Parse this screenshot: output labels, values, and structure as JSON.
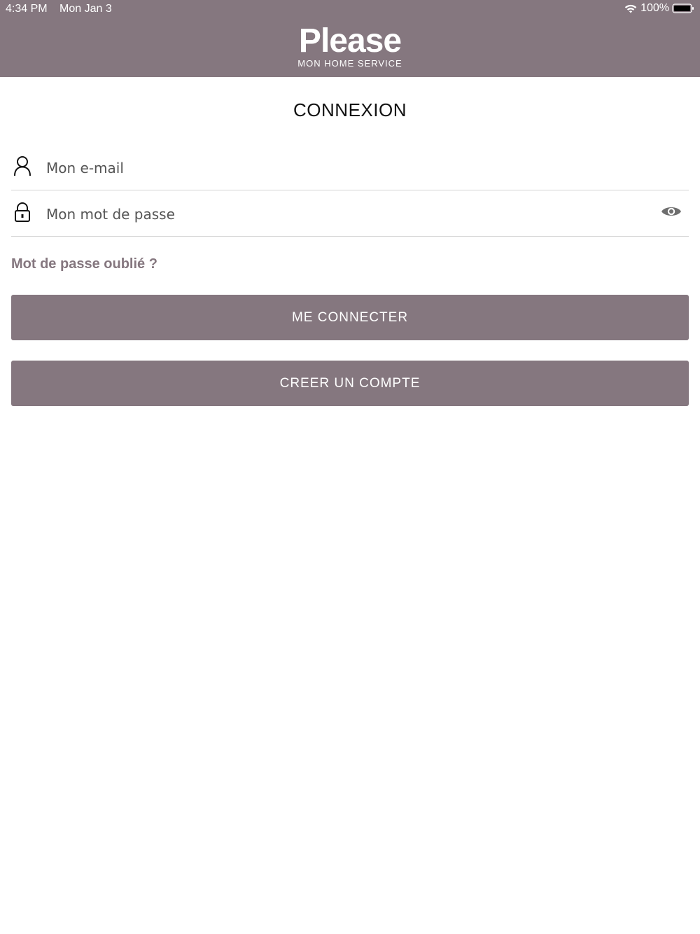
{
  "status_bar": {
    "time": "4:34 PM",
    "date": "Mon Jan 3",
    "battery": "100%"
  },
  "header": {
    "logo_title": "Please",
    "logo_subtitle": "MON HOME SERVICE",
    "background_color": "#85777f"
  },
  "page": {
    "title": "CONNEXION"
  },
  "form": {
    "email": {
      "placeholder": "Mon e-mail",
      "value": "",
      "icon": "user-icon"
    },
    "password": {
      "placeholder": "Mon mot de passe",
      "value": "",
      "icon": "lock-icon",
      "toggle_icon": "eye-icon"
    },
    "forgot_password": "Mot de passe oublié ?",
    "login_button": "ME CONNECTER",
    "register_button": "CREER UN COMPTE"
  },
  "colors": {
    "accent": "#85777f",
    "divider": "#d3d3d3"
  }
}
